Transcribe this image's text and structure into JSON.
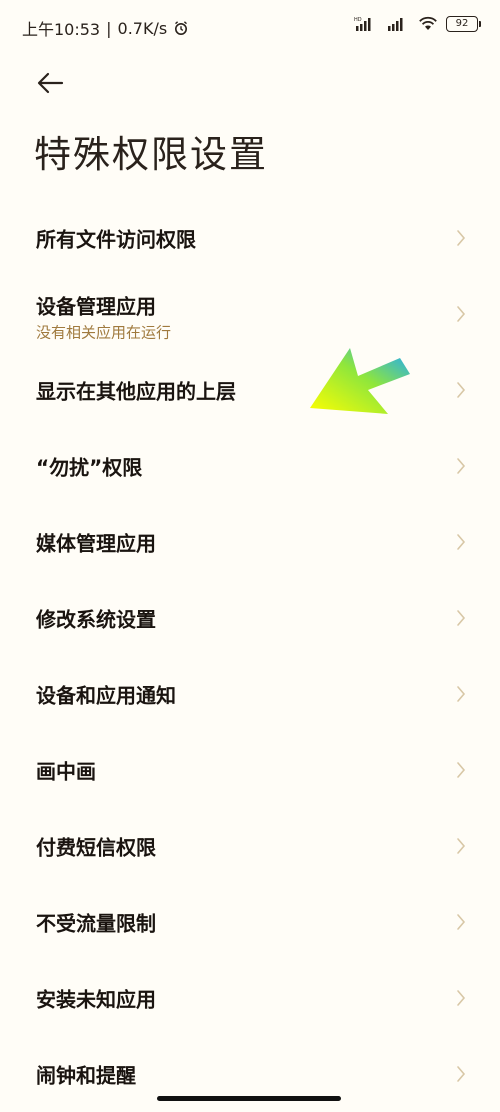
{
  "status_bar": {
    "time": "上午10:53",
    "separator": "|",
    "speed": "0.7K/s",
    "battery": "92",
    "hd_label": "HD"
  },
  "header": {
    "title": "特殊权限设置"
  },
  "items": [
    {
      "label": "所有文件访问权限"
    },
    {
      "label": "设备管理应用",
      "sub": "没有相关应用在运行"
    },
    {
      "label": "显示在其他应用的上层"
    },
    {
      "label": "“勿扰”权限"
    },
    {
      "label": "媒体管理应用"
    },
    {
      "label": "修改系统设置"
    },
    {
      "label": "设备和应用通知"
    },
    {
      "label": "画中画"
    },
    {
      "label": "付费短信权限"
    },
    {
      "label": "不受流量限制"
    },
    {
      "label": "安装未知应用"
    },
    {
      "label": "闹钟和提醒"
    }
  ],
  "colors": {
    "background": "#fffdf7",
    "subtitle": "#a07a3e",
    "chevron": "#d8c7a6",
    "arrow_start": "#ffff00",
    "arrow_end": "#1aa7ff"
  },
  "icons": [
    "alarm-icon",
    "signal-icon",
    "wifi-icon",
    "battery-icon",
    "back-arrow-icon",
    "chevron-right-icon"
  ]
}
